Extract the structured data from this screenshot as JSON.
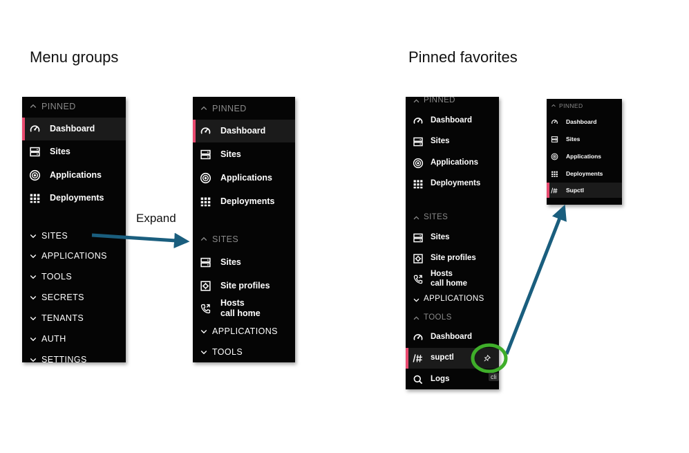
{
  "titles": {
    "menu_groups": "Menu groups",
    "pinned_favorites": "Pinned favorites"
  },
  "annotation": {
    "expand": "Expand",
    "tooltip_fragment": "cli"
  },
  "colors": {
    "active_accent": "#e84a6f",
    "arrow": "#1a5e7e",
    "highlight_ring": "#3fae2a",
    "menu_bg": "#050505"
  },
  "menus": [
    {
      "id": "menu1",
      "rows": [
        {
          "kind": "group",
          "label": "PINNED",
          "chevron": "up",
          "dim": true
        },
        {
          "kind": "item",
          "label": "Dashboard",
          "icon": "dashboard-icon",
          "active": true
        },
        {
          "kind": "item",
          "label": "Sites",
          "icon": "sites-icon"
        },
        {
          "kind": "item",
          "label": "Applications",
          "icon": "applications-icon"
        },
        {
          "kind": "item",
          "label": "Deployments",
          "icon": "deployments-icon"
        },
        {
          "kind": "group",
          "label": "SITES",
          "chevron": "down"
        },
        {
          "kind": "group",
          "label": "APPLICATIONS",
          "chevron": "down"
        },
        {
          "kind": "group",
          "label": "TOOLS",
          "chevron": "down"
        },
        {
          "kind": "group",
          "label": "SECRETS",
          "chevron": "down"
        },
        {
          "kind": "group",
          "label": "TENANTS",
          "chevron": "down"
        },
        {
          "kind": "group",
          "label": "AUTH",
          "chevron": "down"
        },
        {
          "kind": "group",
          "label": "SETTINGS",
          "chevron": "down"
        }
      ]
    },
    {
      "id": "menu2",
      "rows": [
        {
          "kind": "group",
          "label": "PINNED",
          "chevron": "up",
          "dim": true
        },
        {
          "kind": "item",
          "label": "Dashboard",
          "icon": "dashboard-icon",
          "active": true
        },
        {
          "kind": "item",
          "label": "Sites",
          "icon": "sites-icon"
        },
        {
          "kind": "item",
          "label": "Applications",
          "icon": "applications-icon"
        },
        {
          "kind": "item",
          "label": "Deployments",
          "icon": "deployments-icon"
        },
        {
          "kind": "group",
          "label": "SITES",
          "chevron": "up",
          "dim": true
        },
        {
          "kind": "item",
          "label": "Sites",
          "icon": "sites-icon"
        },
        {
          "kind": "item",
          "label": "Site profiles",
          "icon": "site-profiles-icon"
        },
        {
          "kind": "item",
          "label": "Hosts",
          "label2": "call home",
          "icon": "phone-icon"
        },
        {
          "kind": "group",
          "label": "APPLICATIONS",
          "chevron": "down"
        },
        {
          "kind": "group",
          "label": "TOOLS",
          "chevron": "down"
        }
      ]
    },
    {
      "id": "menu3",
      "rows": [
        {
          "kind": "group",
          "label": "PINNED",
          "chevron": "up",
          "dim": true
        },
        {
          "kind": "item",
          "label": "Dashboard",
          "icon": "dashboard-icon"
        },
        {
          "kind": "item",
          "label": "Sites",
          "icon": "sites-icon"
        },
        {
          "kind": "item",
          "label": "Applications",
          "icon": "applications-icon"
        },
        {
          "kind": "item",
          "label": "Deployments",
          "icon": "deployments-icon"
        },
        {
          "kind": "group",
          "label": "SITES",
          "chevron": "up",
          "dim": true
        },
        {
          "kind": "item",
          "label": "Sites",
          "icon": "sites-icon"
        },
        {
          "kind": "item",
          "label": "Site profiles",
          "icon": "site-profiles-icon"
        },
        {
          "kind": "item",
          "label": "Hosts",
          "label2": "call home",
          "icon": "phone-icon"
        },
        {
          "kind": "group",
          "label": "APPLICATIONS",
          "chevron": "down"
        },
        {
          "kind": "group",
          "label": "TOOLS",
          "chevron": "up",
          "dim": true
        },
        {
          "kind": "item",
          "label": "Dashboard",
          "icon": "dashboard-icon"
        },
        {
          "kind": "item",
          "label": "supctl",
          "icon": "supctl-icon",
          "active": true,
          "pin": true
        },
        {
          "kind": "item",
          "label": "Logs",
          "icon": "search-icon"
        }
      ]
    },
    {
      "id": "menu4",
      "rows": [
        {
          "kind": "group",
          "label": "PINNED",
          "chevron": "up",
          "dim": true
        },
        {
          "kind": "item",
          "label": "Dashboard",
          "icon": "dashboard-icon"
        },
        {
          "kind": "item",
          "label": "Sites",
          "icon": "sites-icon"
        },
        {
          "kind": "item",
          "label": "Applications",
          "icon": "applications-icon"
        },
        {
          "kind": "item",
          "label": "Deployments",
          "icon": "deployments-icon"
        },
        {
          "kind": "item",
          "label": "Supctl",
          "icon": "supctl-icon",
          "active": true
        }
      ]
    }
  ]
}
